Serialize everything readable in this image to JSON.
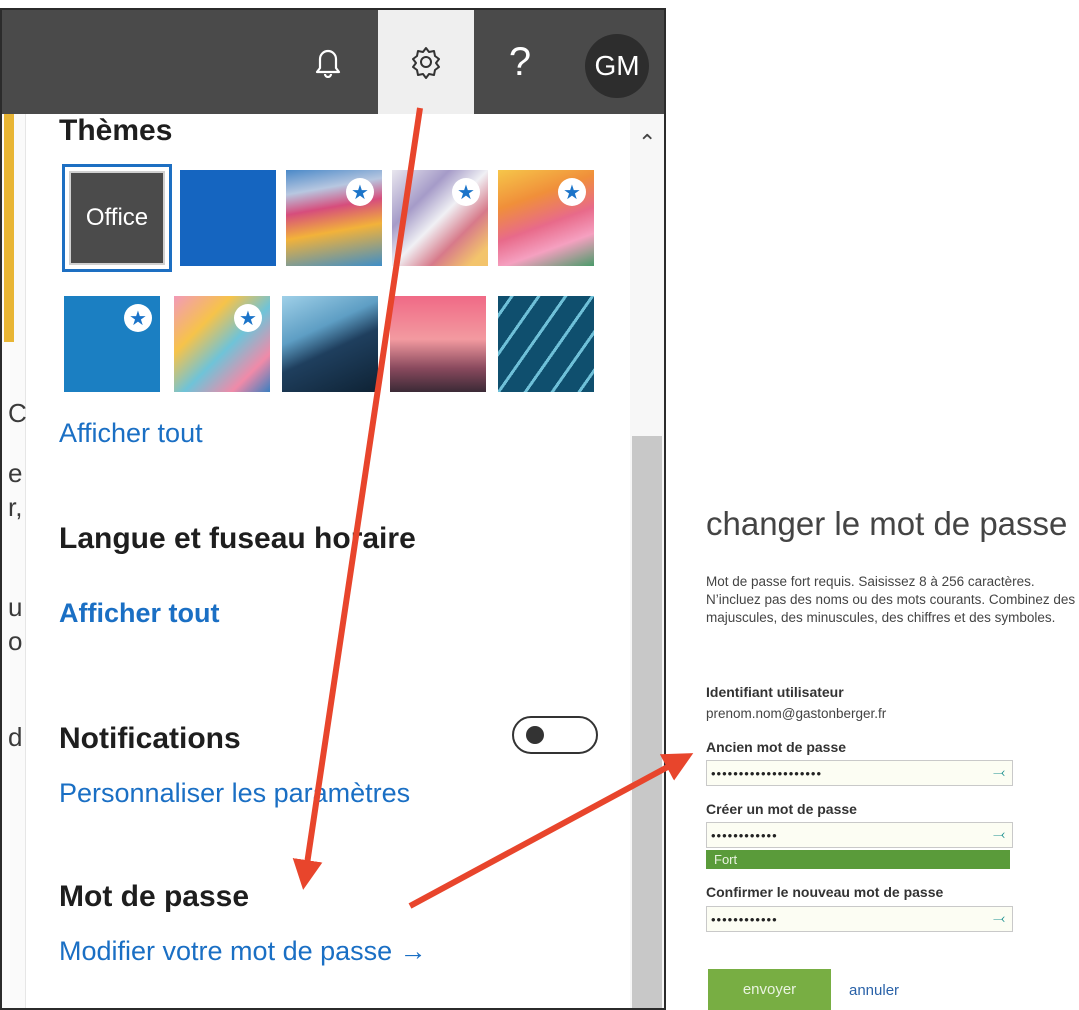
{
  "topbar": {
    "bell_icon": "bell-icon",
    "gear_icon": "gear-icon",
    "help_label": "?",
    "avatar_initials": "GM"
  },
  "left_edge_fragments": [
    "C",
    "e",
    "r,",
    "u",
    "o",
    "d"
  ],
  "settings": {
    "themes": {
      "title": "Thèmes",
      "items": [
        {
          "label": "Office",
          "selected": true
        },
        {
          "label": "",
          "color": "#1565c0"
        },
        {
          "label": "",
          "featured": true
        },
        {
          "label": "",
          "featured": true
        },
        {
          "label": "",
          "featured": true
        },
        {
          "label": "",
          "featured": true
        },
        {
          "label": "",
          "featured": true
        },
        {
          "label": ""
        },
        {
          "label": ""
        },
        {
          "label": ""
        }
      ],
      "show_all": "Afficher tout"
    },
    "language": {
      "title": "Langue et fuseau horaire",
      "show_all": "Afficher tout"
    },
    "notifications": {
      "title": "Notifications",
      "toggle_on": false,
      "customize": "Personnaliser les paramètres"
    },
    "password": {
      "title": "Mot de passe",
      "change_link": "Modifier votre mot de passe →"
    }
  },
  "password_form": {
    "title": "changer le mot de passe",
    "help": "Mot de passe fort requis. Saisissez 8 à 256 caractères. N’incluez pas des noms ou des mots courants. Combinez des majuscules, des minuscules, des chiffres et des symboles.",
    "user_id_label": "Identifiant utilisateur",
    "user_id_value": "prenom.nom@gastonberger.fr",
    "old_password_label": "Ancien mot de passe",
    "old_password_value": "••••••••••••••••••••",
    "new_password_label": "Créer un mot de passe",
    "new_password_value": "••••••••••••",
    "strength_label": "Fort",
    "confirm_label": "Confirmer le nouveau mot de passe",
    "confirm_value": "••••••••••••",
    "submit_label": "envoyer",
    "cancel_label": "annuler"
  },
  "colors": {
    "link": "#1a6fc4",
    "topbar": "#4a4a4a",
    "strength": "#5a9b3a",
    "submit": "#78ae43",
    "arrow": "#e8452c"
  }
}
